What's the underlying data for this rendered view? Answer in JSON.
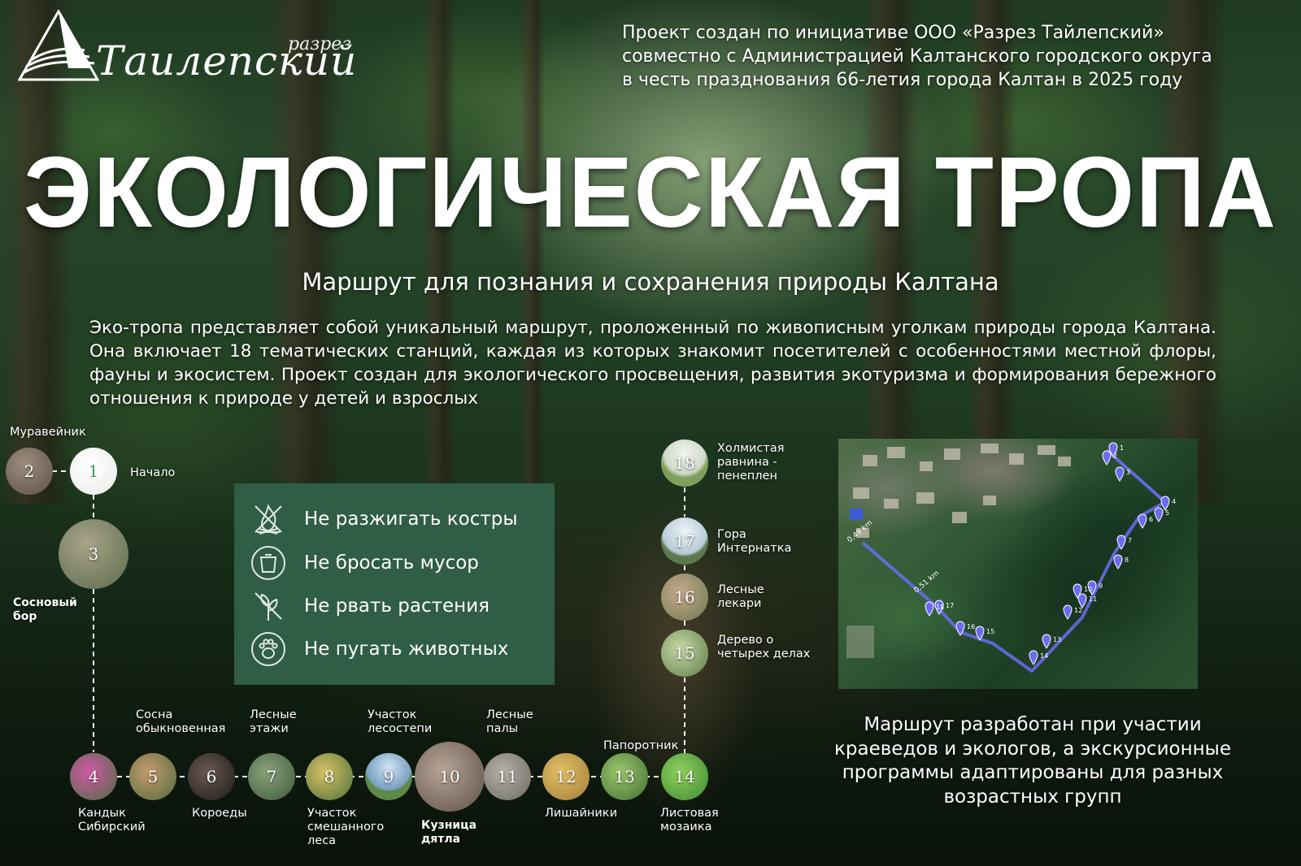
{
  "logo": {
    "sub": "разрез",
    "main": "Таилепский"
  },
  "initiative": [
    "Проект создан по инициативе ООО «Разрез Тайлепский»",
    "совместно с Администрацией Калтанского городского округа",
    "в честь празднования 66-летия города Калтан в 2025 году"
  ],
  "title": "ЭКОЛОГИЧЕСКАЯ ТРОПА",
  "subtitle": "Маршрут для познания и сохранения природы Калтана",
  "description": "Эко-тропа представляет собой уникальный маршрут, проложенный по живописным уголкам природы города Калтана. Она включает 18 тематических станций, каждая из которых знакомит посетителей с особенностями местной флоры, фауны и экосистем. Проект создан для экологического просвещения, развития экотуризма и формирования бережного отношения к природе у детей и взрослых",
  "rules": [
    {
      "icon": "no-fire-icon",
      "label": "Не разжигать костры"
    },
    {
      "icon": "trash-bin-icon",
      "label": "Не бросать мусор"
    },
    {
      "icon": "no-plant-picking-icon",
      "label": "Не рвать растения"
    },
    {
      "icon": "paw-print-icon",
      "label": "Не пугать животных"
    }
  ],
  "stations": [
    {
      "num": "1",
      "label": "Начало"
    },
    {
      "num": "2",
      "label": "Муравейник"
    },
    {
      "num": "3",
      "label": "Сосновый бор"
    },
    {
      "num": "4",
      "label": "Кандык Сибирский"
    },
    {
      "num": "5",
      "label": "Сосна обыкновенная"
    },
    {
      "num": "6",
      "label": "Короеды"
    },
    {
      "num": "7",
      "label": "Лесные этажи"
    },
    {
      "num": "8",
      "label": "Участок смешанного леса"
    },
    {
      "num": "9",
      "label": "Участок лесостепи"
    },
    {
      "num": "10",
      "label": "Кузница дятла"
    },
    {
      "num": "11",
      "label": "Лесные палы"
    },
    {
      "num": "12",
      "label": "Лишайники"
    },
    {
      "num": "13",
      "label": "Папоротник"
    },
    {
      "num": "14",
      "label": "Листовая мозаика"
    },
    {
      "num": "15",
      "label": "Дерево о четырех делах"
    },
    {
      "num": "16",
      "label": "Лесные лекари"
    },
    {
      "num": "17",
      "label": "Гора Интернатка"
    },
    {
      "num": "18",
      "label": "Холмистая равнина - пенеплен"
    }
  ],
  "map": {
    "distance_labels": [
      "0,49 km",
      "0,51 km"
    ],
    "markers": [
      "1",
      "2",
      "3",
      "4",
      "5",
      "6",
      "7",
      "8",
      "9",
      "10",
      "11",
      "12",
      "13",
      "14",
      "15",
      "16",
      "17",
      "18"
    ],
    "route_color": "#6b6cf0"
  },
  "credit": [
    "Маршрут разработан при участии",
    "краеведов и экологов, а экскурсионные",
    "программы адаптированы для разных",
    "возрастных групп"
  ],
  "colors": {
    "rules_bg": "#2f5d46",
    "station_1_text": "#3a9a57",
    "trail_dash": "#ffffff"
  }
}
